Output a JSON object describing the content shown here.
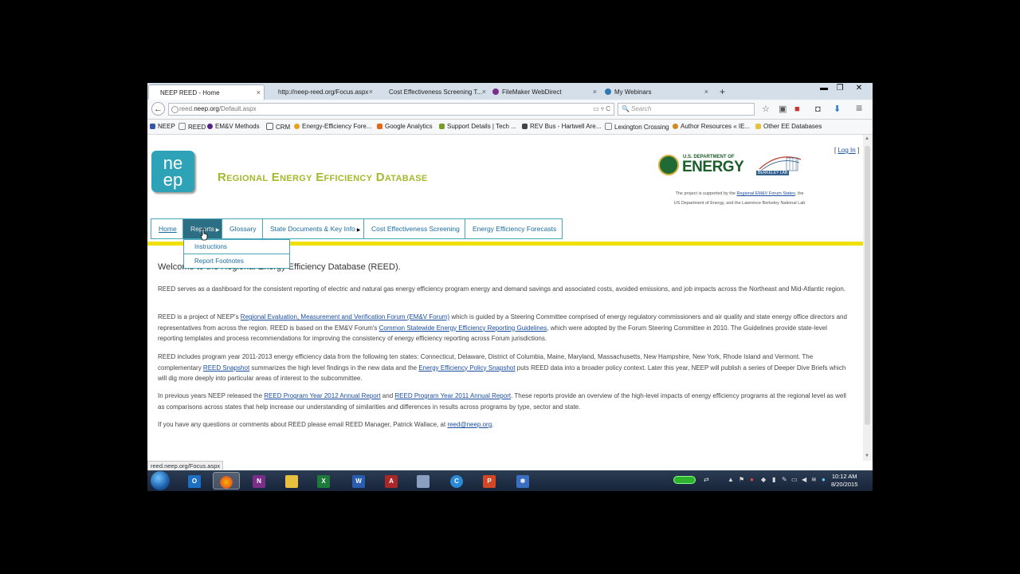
{
  "browser": {
    "tabs": [
      {
        "label": "NEEP REED - Home",
        "active": true
      },
      {
        "label": "http://neep-reed.org/Focus.aspx",
        "active": false
      },
      {
        "label": "Cost Effectiveness Screening T...",
        "active": false
      },
      {
        "label": "FileMaker WebDirect",
        "active": false
      },
      {
        "label": "My Webinars",
        "active": false
      }
    ],
    "new_tab": "+",
    "window_controls": {
      "minimize": "▬",
      "restore": "❐",
      "close": "✕"
    },
    "tab_close": "×",
    "back": "←",
    "url_prefix": "reed.",
    "url_domain": "neep.org",
    "url_path": "/Default.aspx",
    "url_tools": "▭ ▿ C",
    "search_placeholder": "Search",
    "search_icon": "🔍",
    "toolbar_icons": {
      "star": "☆",
      "clipboard": "▣",
      "pocket": "◘",
      "download": "⬇",
      "menu": "≡"
    },
    "bookmarks": [
      {
        "label": "NEEP",
        "color": "#3355aa"
      },
      {
        "label": "REED",
        "color": "#ffffff"
      },
      {
        "label": "EM&V Methods",
        "color": "#552288"
      },
      {
        "label": "CRM",
        "color": "#999999"
      },
      {
        "label": "Energy-Efficiency Fore...",
        "color": "#e8a020"
      },
      {
        "label": "Google Analytics",
        "color": "#e8661a"
      },
      {
        "label": "Support Details | Tech ...",
        "color": "#7a9a2a"
      },
      {
        "label": "REV Bus - Hartwell Are...",
        "color": "#444444"
      },
      {
        "label": "Lexington Crossing",
        "color": "#ffffff"
      },
      {
        "label": "Author Resources « IE...",
        "color": "#d08a20"
      },
      {
        "label": "Other EE Databases",
        "color": "#e8c040"
      }
    ],
    "status_url": "reed.neep.org/Focus.aspx"
  },
  "page": {
    "logo_line1": "ne",
    "logo_line2": "ep",
    "title": "Regional Energy Efficiency Database",
    "login_open": "[",
    "login": "Log In",
    "login_close": "]",
    "doe_small": "U.S. DEPARTMENT OF",
    "doe_big": "ENERGY",
    "berkeley_label": "BERKELEY LAB",
    "support_prefix": "The project is supported by the",
    "support_link": "Regional EM&V Forum States",
    "support_mid": ", the",
    "support_line2": "US Department of Energy, and the Lawrence Berkeley National Lab",
    "menu": [
      {
        "label": "Home",
        "arrow": ""
      },
      {
        "label": "Reports",
        "arrow": "▶"
      },
      {
        "label": "Glossary",
        "arrow": ""
      },
      {
        "label": "State Documents & Key Info",
        "arrow": "▶"
      },
      {
        "label": "Cost Effectiveness Screening",
        "arrow": ""
      },
      {
        "label": "Energy Efficiency Forecasts",
        "arrow": ""
      }
    ],
    "dropdown": [
      "Instructions",
      "Report Footnotes"
    ],
    "welcome": "Welcome to the Regional Energy Efficiency Database (REED).",
    "p1": "REED serves as a dashboard for the consistent reporting of electric and natural gas energy efficiency program energy and demand savings and associated costs, avoided emissions, and job impacts across the Northeast and Mid-Atlantic region.",
    "p2_a": "REED is a project of NEEP's ",
    "p2_link1": "Regional Evaluation, Measurement and Verification Forum (EM&V Forum)",
    "p2_b": " which is guided by a Steering Committee comprised of energy regulatory commissioners and air quality and state energy office directors and representatives from across the region.  REED is based on the EM&V Forum's ",
    "p2_link2": "Common Statewide Energy Efficiency Reporting Guidelines",
    "p2_c": ", which were adopted by the Forum Steering Committee in 2010. The Guidelines provide state-level reporting templates and process recommendations for improving the consistency of energy efficiency reporting across Forum jurisdictions.",
    "p3_a": "REED includes program year 2011-2013 energy efficiency data from the following ten states: Connecticut, Delaware, District of Columbia, Maine, Maryland, Massachusetts, New Hampshire, New York, Rhode Island and Vermont.  The complementary ",
    "p3_link1": "REED Snapshot",
    "p3_b": " summarizes the high level findings in the new data and the ",
    "p3_link2": "Energy Efficiency Policy Snapshot",
    "p3_c": " puts REED data into a broader policy context. Later this year, NEEP will publish a series of Deeper Dive Briefs which will dig more deeply into particular areas of interest to the subcommittee.",
    "p4_a": "In previous years NEEP released the  ",
    "p4_link1": "REED Program Year 2012 Annual Report",
    "p4_b": " and ",
    "p4_link2": "REED Program Year 2011 Annual Report",
    "p4_c": ". These reports provide an overview of the high-level impacts of energy efficiency programs at the regional level as well as comparisons across states that help increase our understanding of similarities and differences in results across programs by type, sector and state.",
    "p5_a": "If you have any questions or comments about REED please email REED Manager, Patrick Wallace, at ",
    "p5_link": "reed@neep.org",
    "p5_b": "."
  },
  "taskbar": {
    "apps": [
      {
        "name": "outlook",
        "glyph": "O",
        "color": "#1d6fc4"
      },
      {
        "name": "firefox",
        "glyph": "",
        "color": "#e8661a"
      },
      {
        "name": "onenote",
        "glyph": "N",
        "color": "#7a2e8a"
      },
      {
        "name": "explorer",
        "glyph": "",
        "color": "#e8c040"
      },
      {
        "name": "excel",
        "glyph": "X",
        "color": "#1d7a3a"
      },
      {
        "name": "word",
        "glyph": "W",
        "color": "#2a5cb0"
      },
      {
        "name": "access",
        "glyph": "A",
        "color": "#a82828"
      },
      {
        "name": "calculator",
        "glyph": "",
        "color": "#8aa0c0"
      },
      {
        "name": "chrome",
        "glyph": "C",
        "color": "#2a8ad8"
      },
      {
        "name": "powerpoint",
        "glyph": "P",
        "color": "#d24726"
      },
      {
        "name": "snowflake",
        "glyph": "❄",
        "color": "#3a6ec0"
      }
    ],
    "time": "10:12 AM",
    "date": "8/20/2015"
  },
  "colors": {
    "title": "#a5b92d",
    "menu_border": "#4aa7b8",
    "menu_active": "#2c6e83",
    "yellow_bar": "#f0e00c",
    "link": "#1a4ea3"
  }
}
